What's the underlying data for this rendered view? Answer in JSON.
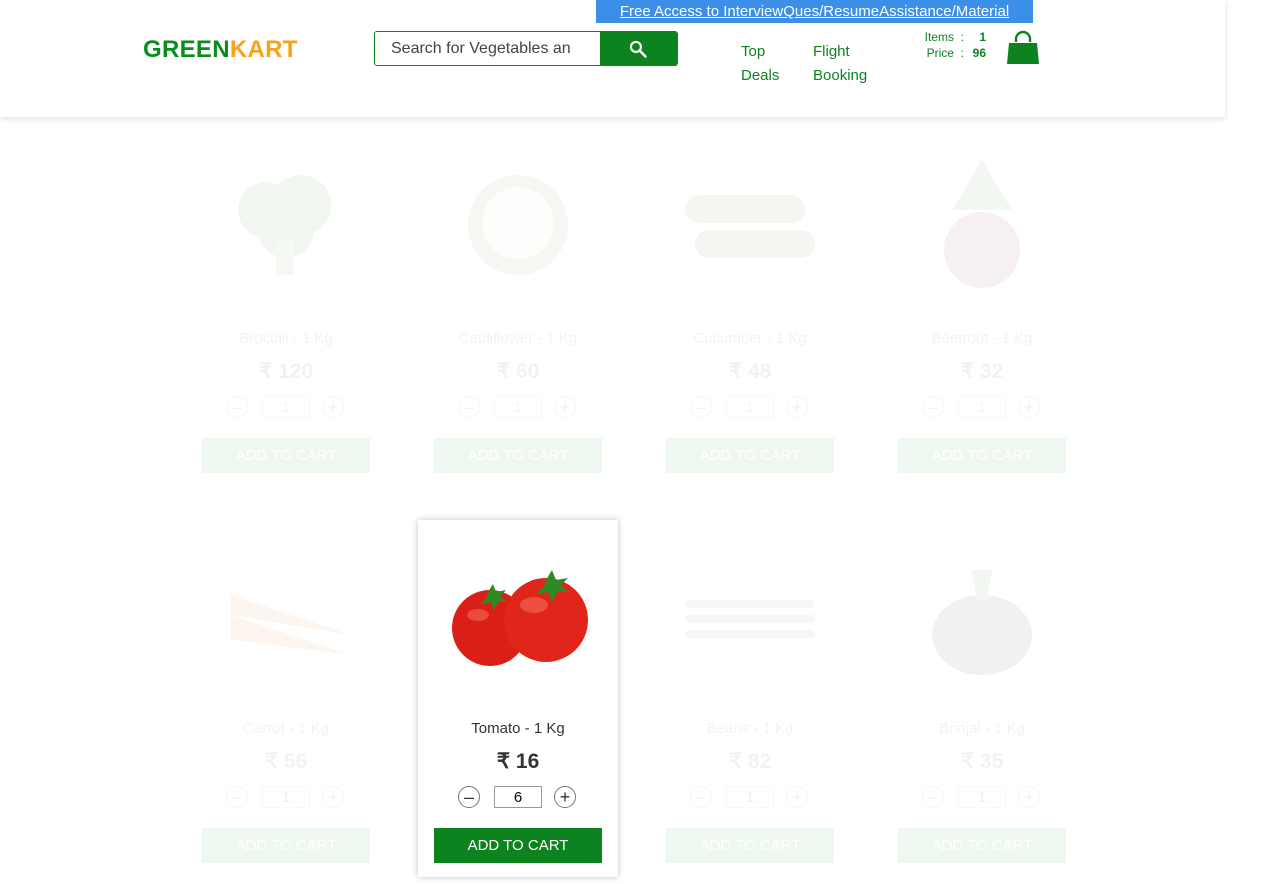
{
  "header": {
    "logo_part1": "GREEN",
    "logo_part2": "KART",
    "search_placeholder": "Search for Vegetables and Fruits",
    "search_icon": "search-icon",
    "promo_text": "Free Access to InterviewQues/ResumeAssistance/Material",
    "nav_top_deals": "Top Deals",
    "nav_flight_booking": "Flight Booking",
    "items_label": "Items",
    "items_value": "1",
    "price_label": "Price",
    "price_value": "96",
    "separator": ":",
    "cart_icon": "shopping-bag-icon"
  },
  "products": [
    {
      "name": "Brocolli - 1 Kg",
      "price": "₹ 120",
      "qty": "1",
      "add_label": "ADD TO CART",
      "dec": "–",
      "inc": "+"
    },
    {
      "name": "Cauliflower - 1 Kg",
      "price": "₹ 60",
      "qty": "1",
      "add_label": "ADD TO CART",
      "dec": "–",
      "inc": "+"
    },
    {
      "name": "Cucumber - 1 Kg",
      "price": "₹ 48",
      "qty": "1",
      "add_label": "ADD TO CART",
      "dec": "–",
      "inc": "+"
    },
    {
      "name": "Beetroot - 1 Kg",
      "price": "₹ 32",
      "qty": "1",
      "add_label": "ADD TO CART",
      "dec": "–",
      "inc": "+"
    },
    {
      "name": "Carrot - 1 Kg",
      "price": "₹ 56",
      "qty": "1",
      "add_label": "ADD TO CART",
      "dec": "–",
      "inc": "+"
    },
    {
      "name": "Tomato - 1 Kg",
      "price": "₹ 16",
      "qty": "6",
      "add_label": "ADD TO CART",
      "dec": "–",
      "inc": "+"
    },
    {
      "name": "Beans - 1 Kg",
      "price": "₹ 82",
      "qty": "1",
      "add_label": "ADD TO CART",
      "dec": "–",
      "inc": "+"
    },
    {
      "name": "Brinjal - 1 Kg",
      "price": "₹ 35",
      "qty": "1",
      "add_label": "ADD TO CART",
      "dec": "–",
      "inc": "+"
    }
  ],
  "colors": {
    "brand_green": "#0c831f",
    "brand_orange": "#f7a21b",
    "promo_blue": "#3c8fe8"
  }
}
